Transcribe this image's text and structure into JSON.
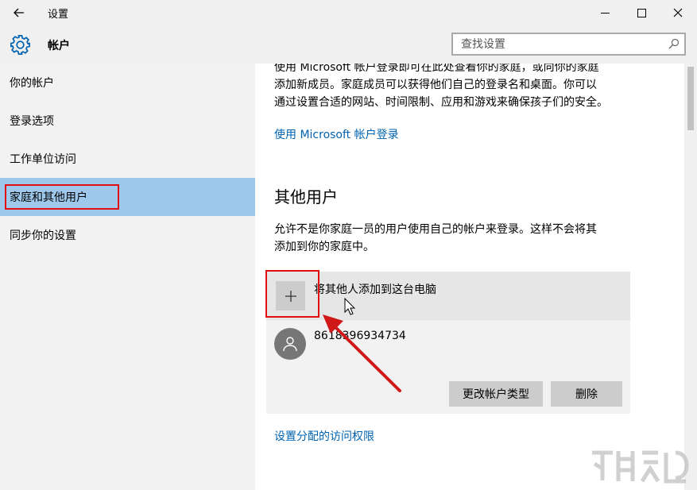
{
  "window": {
    "title": "设置",
    "back_icon": "arrow-left-icon",
    "minimize_icon": "minimize-icon",
    "maximize_icon": "maximize-icon",
    "close_icon": "close-icon"
  },
  "header": {
    "icon": "gear-icon",
    "title": "帐户",
    "search_placeholder": "查找设置",
    "search_icon": "search-icon"
  },
  "sidebar": {
    "items": [
      {
        "label": "你的帐户",
        "selected": false
      },
      {
        "label": "登录选项",
        "selected": false
      },
      {
        "label": "工作单位访问",
        "selected": false
      },
      {
        "label": "家庭和其他用户",
        "selected": true
      },
      {
        "label": "同步你的设置",
        "selected": false
      }
    ]
  },
  "main": {
    "family_text_line1": "使用 Microsoft 帐户登录即可在此处查看你的家庭，或向你的家庭",
    "family_text_line2": "添加新成员。家庭成员可以获得他们自己的登录名和桌面。你可以",
    "family_text_line3": "通过设置合适的网站、时间限制、应用和游戏来确保孩子们的安全。",
    "signin_link": "使用 Microsoft 帐户登录",
    "other_users_title": "其他用户",
    "other_users_text_line1": "允许不是你家庭一员的用户使用自己的帐户来登录。这样不会将其",
    "other_users_text_line2": "添加到你的家庭中。",
    "add_user_label": "将其他人添加到这台电脑",
    "user": {
      "name": "8618396934734",
      "change_type_button": "更改帐户类型",
      "delete_button": "删除"
    },
    "assigned_access_link": "设置分配的访问权限"
  },
  "colors": {
    "selected_item": "#9fc9ec",
    "link": "#0063b1",
    "annotation": "#e01010"
  }
}
